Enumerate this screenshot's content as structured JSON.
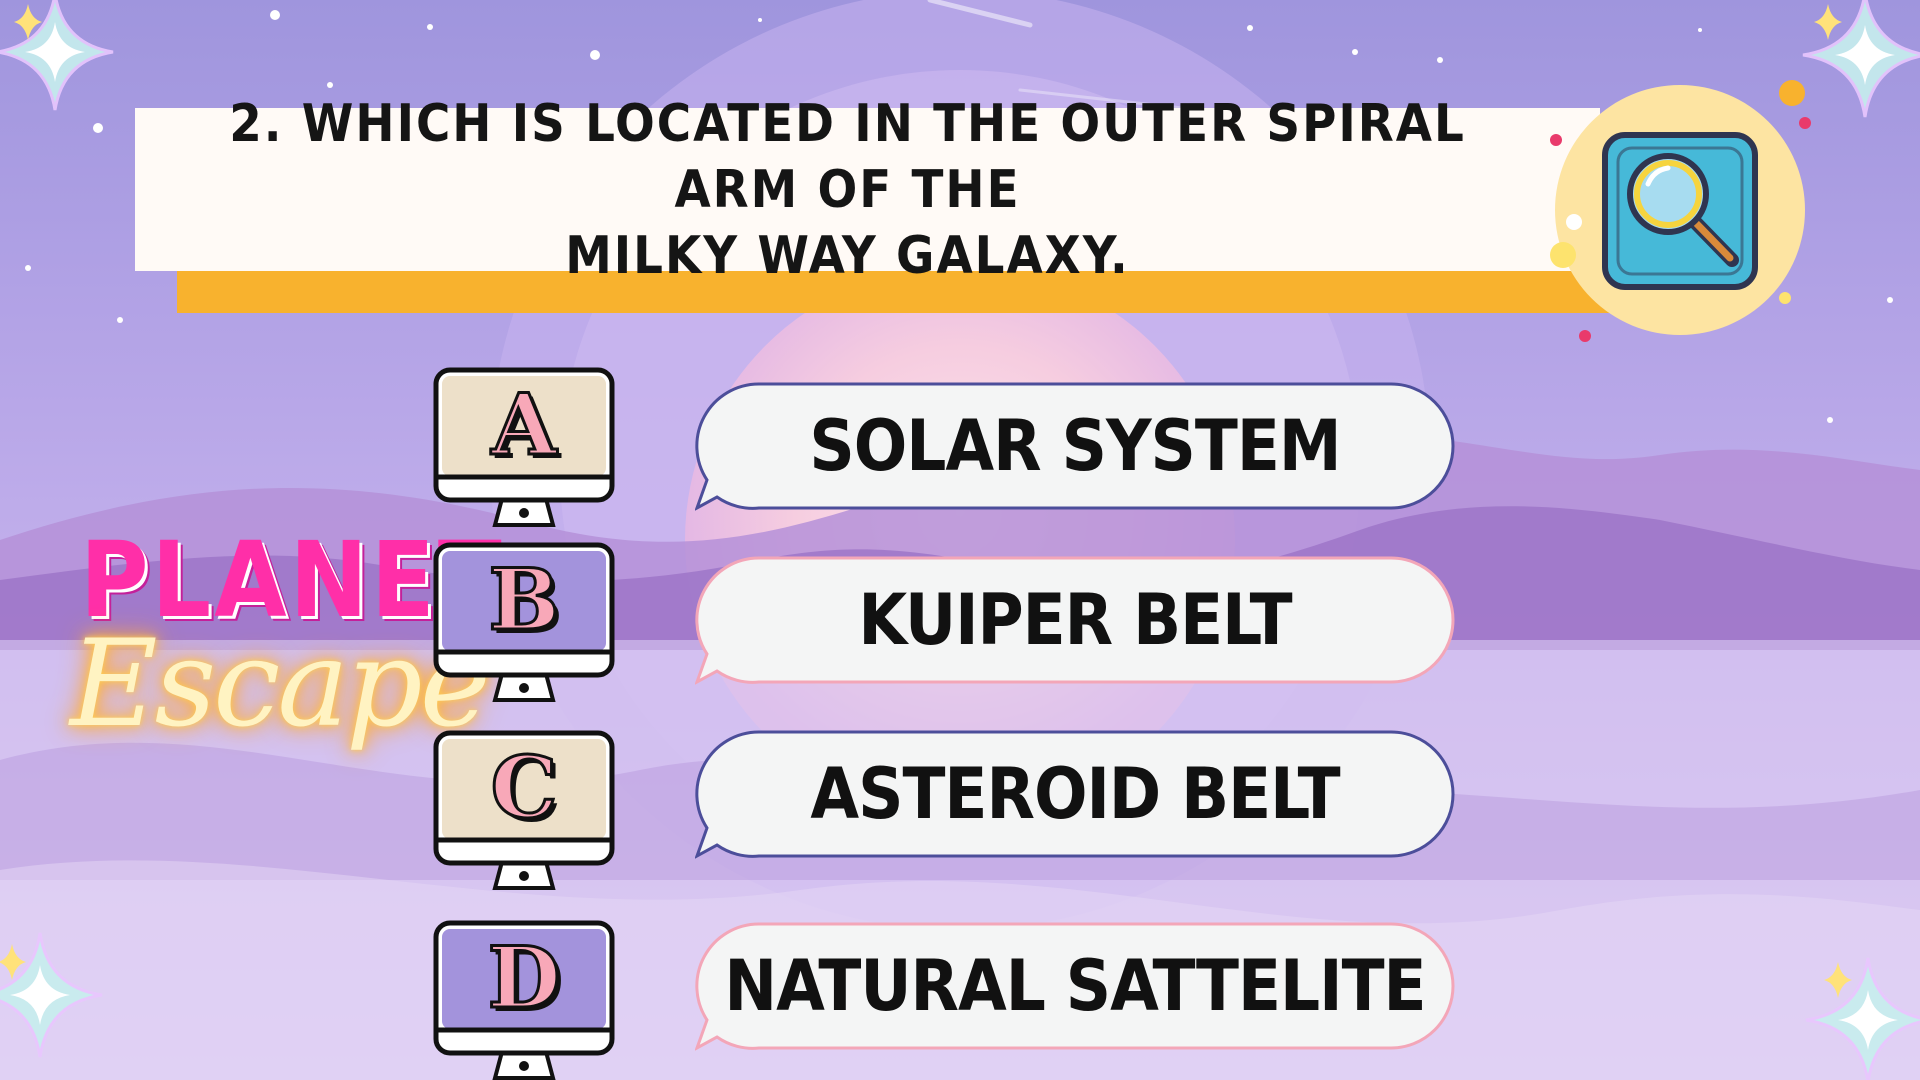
{
  "question": {
    "line1": "2. Which is located in the outer spiral arm of the",
    "line2": "Milky Way Galaxy."
  },
  "logo": {
    "top": "PLANET",
    "bottom": "Escape"
  },
  "answers": [
    {
      "letter": "A",
      "text": "SOLAR SYSTEM",
      "screen_color": "#ede0c9",
      "outline": "#4c4e9a"
    },
    {
      "letter": "B",
      "text": "KUIPER BELT",
      "screen_color": "#a393dc",
      "outline": "#f3a6b8"
    },
    {
      "letter": "C",
      "text": "ASTEROID BELT",
      "screen_color": "#ede0c9",
      "outline": "#4c4e9a"
    },
    {
      "letter": "D",
      "text": "NATURAL SATTELITE",
      "screen_color": "#a393dc",
      "outline": "#f3a6b8"
    }
  ],
  "icons": {
    "question_badge": "magnifying-glass-icon",
    "decorations": "sparkle-star-icon"
  },
  "colors": {
    "accent_yellow": "#f8b22e",
    "logo_pink": "#ff2fa8",
    "logo_glow": "#ffcf52",
    "badge_teal": "#46b9d8"
  }
}
